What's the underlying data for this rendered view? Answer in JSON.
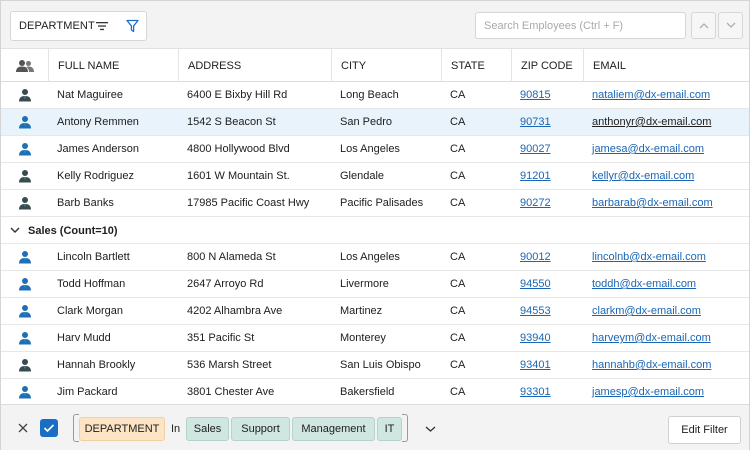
{
  "toolbar": {
    "group_panel_label": "DEPARTMENT",
    "sort_icon": "sort-lines-icon",
    "filter_icon": "funnel-icon",
    "search_placeholder": "Search Employees (Ctrl + F)",
    "search_value": "",
    "nav_up_icon": "chevron-up-icon",
    "nav_down_icon": "chevron-down-icon"
  },
  "grid": {
    "columns": [
      "",
      "FULL NAME",
      "ADDRESS",
      "CITY",
      "STATE",
      "ZIP CODE",
      "EMAIL"
    ],
    "header_icon": "users-icon",
    "rows_top": [
      {
        "name": "Nat Maguiree",
        "address": "6400 E Bixby Hill Rd",
        "city": "Long Beach",
        "state": "CA",
        "zip": "90815",
        "email": "nataliem@dx-email.com",
        "icon": "person-male-icon",
        "avatar_color": "#3a4a4f"
      },
      {
        "name": "Antony Remmen",
        "address": "1542 S Beacon St",
        "city": "San Pedro",
        "state": "CA",
        "zip": "90731",
        "email": "anthonyr@dx-email.com",
        "icon": "person-male-icon",
        "avatar_color": "#1f6fb8",
        "selected": true
      },
      {
        "name": "James Anderson",
        "address": "4800 Hollywood Blvd",
        "city": "Los Angeles",
        "state": "CA",
        "zip": "90027",
        "email": "jamesa@dx-email.com",
        "icon": "person-male-icon",
        "avatar_color": "#1f6fb8"
      },
      {
        "name": "Kelly Rodriguez",
        "address": "1601 W Mountain St.",
        "city": "Glendale",
        "state": "CA",
        "zip": "91201",
        "email": "kellyr@dx-email.com",
        "icon": "person-female-icon",
        "avatar_color": "#3a4a4f"
      },
      {
        "name": "Barb Banks",
        "address": "17985 Pacific Coast Hwy",
        "city": "Pacific Palisades",
        "state": "CA",
        "zip": "90272",
        "email": "barbarab@dx-email.com",
        "icon": "person-female-icon",
        "avatar_color": "#3a4a4f"
      }
    ],
    "group_row": {
      "label": "Sales (Count=10)",
      "icon": "chevron-down-icon"
    },
    "rows_bottom": [
      {
        "name": "Lincoln Bartlett",
        "address": "800 N Alameda St",
        "city": "Los Angeles",
        "state": "CA",
        "zip": "90012",
        "email": "lincolnb@dx-email.com",
        "icon": "person-male-icon",
        "avatar_color": "#1f6fb8"
      },
      {
        "name": "Todd Hoffman",
        "address": "2647 Arroyo Rd",
        "city": "Livermore",
        "state": "CA",
        "zip": "94550",
        "email": "toddh@dx-email.com",
        "icon": "person-male-icon",
        "avatar_color": "#1f6fb8"
      },
      {
        "name": "Clark Morgan",
        "address": "4202 Alhambra Ave",
        "city": "Martinez",
        "state": "CA",
        "zip": "94553",
        "email": "clarkm@dx-email.com",
        "icon": "person-male-icon",
        "avatar_color": "#1f6fb8"
      },
      {
        "name": "Harv Mudd",
        "address": "351 Pacific St",
        "city": "Monterey",
        "state": "CA",
        "zip": "93940",
        "email": "harveym@dx-email.com",
        "icon": "person-male-icon",
        "avatar_color": "#1f6fb8"
      },
      {
        "name": "Hannah Brookly",
        "address": "536 Marsh Street",
        "city": "San Luis Obispo",
        "state": "CA",
        "zip": "93401",
        "email": "hannahb@dx-email.com",
        "icon": "person-female-icon",
        "avatar_color": "#3a4a4f"
      },
      {
        "name": "Jim Packard",
        "address": "3801 Chester Ave",
        "city": "Bakersfield",
        "state": "CA",
        "zip": "93301",
        "email": "jamesp@dx-email.com",
        "icon": "person-male-icon",
        "avatar_color": "#1f6fb8"
      }
    ]
  },
  "filter_panel": {
    "close_icon": "close-icon",
    "enable_icon": "checkmark-icon",
    "field": "DEPARTMENT",
    "operator": "In",
    "values": [
      "Sales",
      "Support",
      "Management",
      "IT"
    ],
    "expand_icon": "chevron-down-icon",
    "edit_button": "Edit Filter"
  },
  "colors": {
    "accent": "#1a6fc4",
    "link": "#1a66b5",
    "selected_row": "#e9f3fb",
    "field_chip": "#fce4c4",
    "value_chip": "#cfe6e1"
  }
}
